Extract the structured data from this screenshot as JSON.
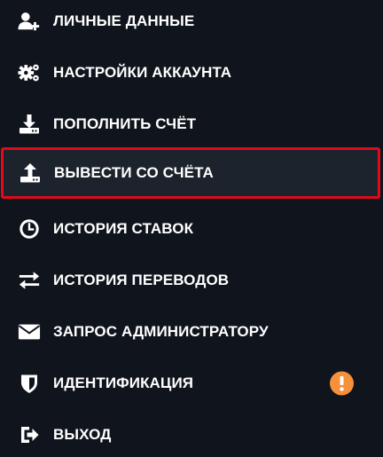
{
  "colors": {
    "background": "#10141d",
    "active_background": "#1d232d",
    "highlight_border": "#e00b1a",
    "badge": "#f7903a",
    "text": "#ffffff"
  },
  "menu": {
    "items": [
      {
        "label": "ЛИЧНЫЕ ДАННЫЕ",
        "icon": "user-add-icon"
      },
      {
        "label": "НАСТРОЙКИ АККАУНТА",
        "icon": "gears-icon"
      },
      {
        "label": "ПОПОЛНИТЬ СЧЁТ",
        "icon": "download-tray-icon"
      },
      {
        "label": "ВЫВЕСТИ СО СЧЁТА",
        "icon": "upload-tray-icon",
        "active": true
      },
      {
        "label": "ИСТОРИЯ СТАВОК",
        "icon": "clock-icon"
      },
      {
        "label": "ИСТОРИЯ ПЕРЕВОДОВ",
        "icon": "transfer-arrows-icon"
      },
      {
        "label": "ЗАПРОС АДМИНИСТРАТОРУ",
        "icon": "envelope-icon"
      },
      {
        "label": "ИДЕНТИФИКАЦИЯ",
        "icon": "shield-icon",
        "badge_icon": "exclamation-icon"
      },
      {
        "label": "ВЫХОД",
        "icon": "sign-out-icon"
      }
    ]
  }
}
